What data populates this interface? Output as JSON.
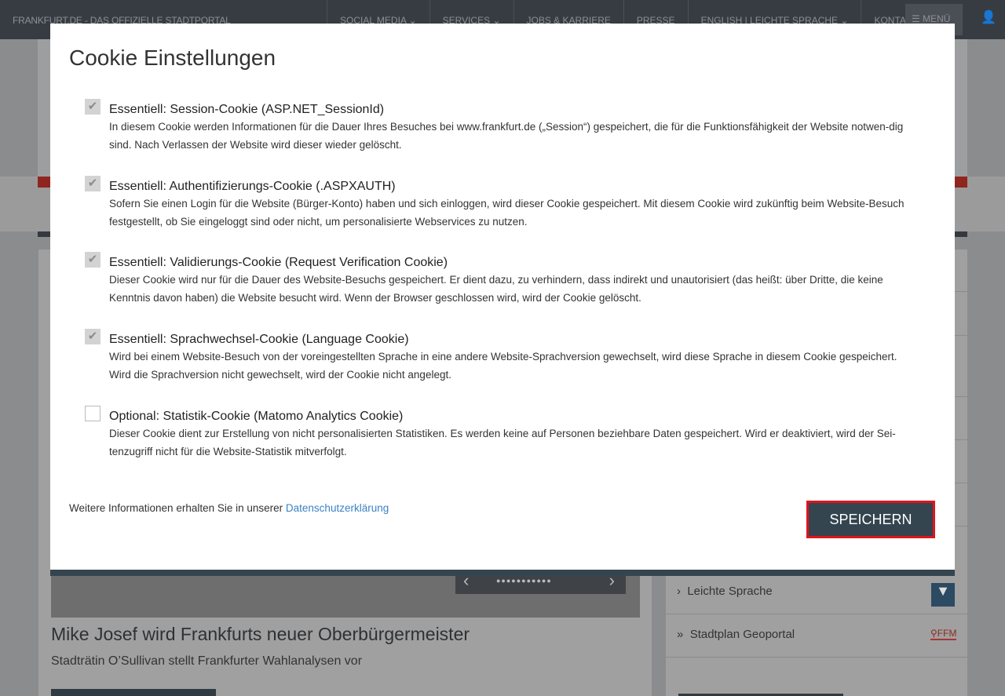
{
  "topbar": {
    "brand": "FRANKFURT.DE - DAS OFFIZIELLE STADTPORTAL",
    "nav": [
      "SOCIAL MEDIA ⌄",
      "SERVICES ⌄",
      "JOBS & KARRIERE",
      "PRESSE",
      "ENGLISH | LEICHTE SPRACHE ⌄",
      "KONTAKT"
    ],
    "menu": "MENÜ"
  },
  "modal": {
    "title": "Cookie Einstellungen",
    "cookies": [
      {
        "title": "Essentiell: Session-Cookie (ASP.NET_SessionId)",
        "desc": "In diesem Cookie werden Informationen für die Dauer Ihres Besuches bei www.frankfurt.de („Session“) gespeichert, die für die Funktionsfähigkeit der Website notwen-dig sind. Nach Verlassen der Website wird dieser wieder gelöscht.",
        "checked": true
      },
      {
        "title": "Essentiell: Authentifizierungs-Cookie (.ASPXAUTH)",
        "desc": "Sofern Sie einen Login für die Website (Bürger-Konto) haben und sich einloggen, wird dieser Cookie gespeichert. Mit diesem Cookie wird zukünftig beim Website-Besuch festgestellt, ob Sie eingeloggt sind oder nicht, um personalisierte Webservices zu nutzen.",
        "checked": true
      },
      {
        "title": "Essentiell: Validierungs-Cookie (Request Verification Cookie)",
        "desc": "Dieser Cookie wird nur für die Dauer des Website-Besuchs gespeichert. Er dient dazu, zu verhindern, dass indirekt und unautorisiert (das heißt: über Dritte, die keine Kenntnis davon haben) die Website besucht wird. Wenn der Browser geschlossen wird, wird der Cookie gelöscht.",
        "checked": true
      },
      {
        "title": "Essentiell: Sprachwechsel-Cookie (Language Cookie)",
        "desc": "Wird bei einem Website-Besuch von der voreingestellten Sprache in eine andere Website-Sprachversion gewechselt, wird diese Sprache in diesem Cookie gespeichert. Wird die Sprachversion nicht gewechselt, wird der Cookie nicht angelegt.",
        "checked": true
      },
      {
        "title": "Optional: Statistik-Cookie (Matomo Analytics Cookie)",
        "desc": "Dieser Cookie dient zur Erstellung von nicht personalisierten Statistiken. Es werden keine auf Personen beziehbare Daten gespeichert. Wird er deaktiviert, wird der Sei-tenzugriff nicht für die Website-Statistik mitverfolgt.",
        "checked": false
      }
    ],
    "footer_text": "Weitere Informationen erhalten Sie in unserer ",
    "footer_link": "Datenschutzerklärung",
    "save": "SPEICHERN"
  },
  "news": {
    "headline": "Mike Josef wird Frankfurts neuer Oberbürgermeister",
    "sub": "Stadträtin O’Sullivan stellt Frankfurter Wahlanalysen vor",
    "dots": "●●●●●●●●●●●"
  },
  "sidebar": {
    "items": [
      "Leichte Sprache",
      "Stadtplan Geoportal"
    ],
    "ffm": "FFM"
  }
}
